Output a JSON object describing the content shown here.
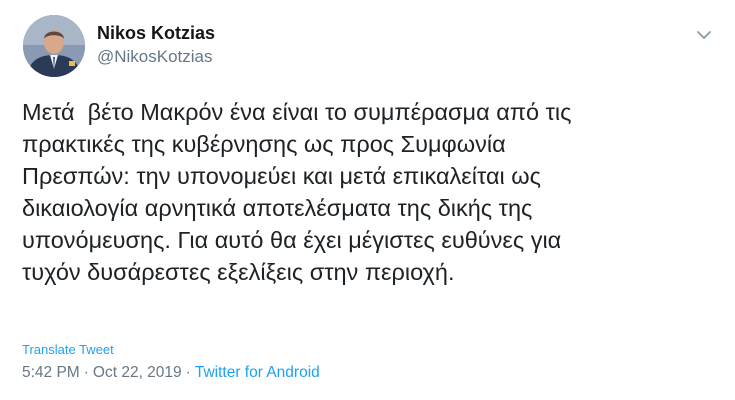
{
  "author": {
    "display_name": "Nikos Kotzias",
    "handle": "@NikosKotzias"
  },
  "tweet": {
    "text": "Μετά  βέτο Μακρόν ένα είναι το συμπέρασμα από τις\nπρακτικές της κυβέρνησης ως προς Συμφωνία\nΠρεσπών: την υπονομεύει και μετά επικαλείται ως\nδικαιολογία αρνητικά αποτελέσματα της δικής της\nυπονόμευσης. Για αυτό θα έχει μέγιστες ευθύνες για\nτυχόν δυσάρεστες εξελίξεις στην περιοχή.",
    "translate_label": "Translate Tweet",
    "time": "5:42 PM",
    "separator": "·",
    "date": "Oct 22, 2019",
    "source": "Twitter for Android"
  },
  "icons": {
    "avatar": "avatar-photo",
    "caret": "chevron-down-icon"
  },
  "colors": {
    "link": "#1da1f2",
    "secondary_text": "#657786",
    "primary_text": "#14171a"
  }
}
